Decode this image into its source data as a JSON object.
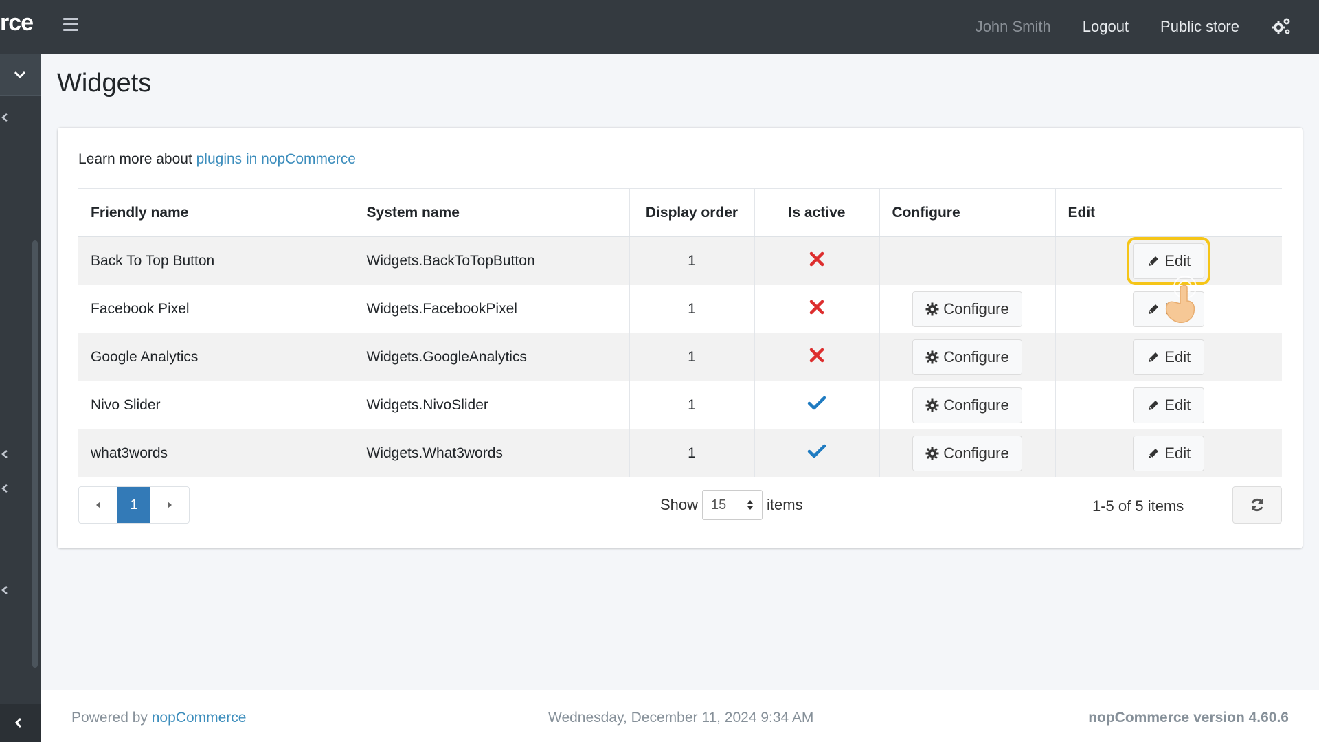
{
  "navbar": {
    "logo_fragment": "rce",
    "user_name": "John Smith",
    "logout_label": "Logout",
    "public_store_label": "Public store",
    "settings_icon": "gears-icon",
    "menu_icon": "hamburger-icon"
  },
  "page": {
    "title": "Widgets",
    "learn_prefix": "Learn more about ",
    "learn_link": "plugins in nopCommerce"
  },
  "table": {
    "headers": {
      "friendly_name": "Friendly name",
      "system_name": "System name",
      "display_order": "Display order",
      "is_active": "Is active",
      "configure": "Configure",
      "edit": "Edit"
    },
    "configure_label": "Configure",
    "edit_label": "Edit",
    "rows": [
      {
        "friendly_name": "Back To Top Button",
        "system_name": "Widgets.BackToTopButton",
        "display_order": "1",
        "is_active": false,
        "has_configure": false
      },
      {
        "friendly_name": "Facebook Pixel",
        "system_name": "Widgets.FacebookPixel",
        "display_order": "1",
        "is_active": false,
        "has_configure": true
      },
      {
        "friendly_name": "Google Analytics",
        "system_name": "Widgets.GoogleAnalytics",
        "display_order": "1",
        "is_active": false,
        "has_configure": true
      },
      {
        "friendly_name": "Nivo Slider",
        "system_name": "Widgets.NivoSlider",
        "display_order": "1",
        "is_active": true,
        "has_configure": true
      },
      {
        "friendly_name": "what3words",
        "system_name": "Widgets.What3words",
        "display_order": "1",
        "is_active": true,
        "has_configure": true
      }
    ]
  },
  "pagination": {
    "current_page": "1",
    "show_label": "Show",
    "page_size": "15",
    "items_label": "items",
    "summary": "1-5 of 5 items"
  },
  "footer": {
    "powered_prefix": "Powered by ",
    "powered_link": "nopCommerce",
    "datetime": "Wednesday, December 11, 2024 9:34 AM",
    "version": "nopCommerce version 4.60.6"
  },
  "colors": {
    "navbar_bg": "#343a40",
    "link": "#3c8dbc",
    "inactive_x": "#dd2e2e",
    "active_check": "#1f7bc1",
    "pager_active": "#337ab7",
    "highlight": "#f5c518"
  }
}
